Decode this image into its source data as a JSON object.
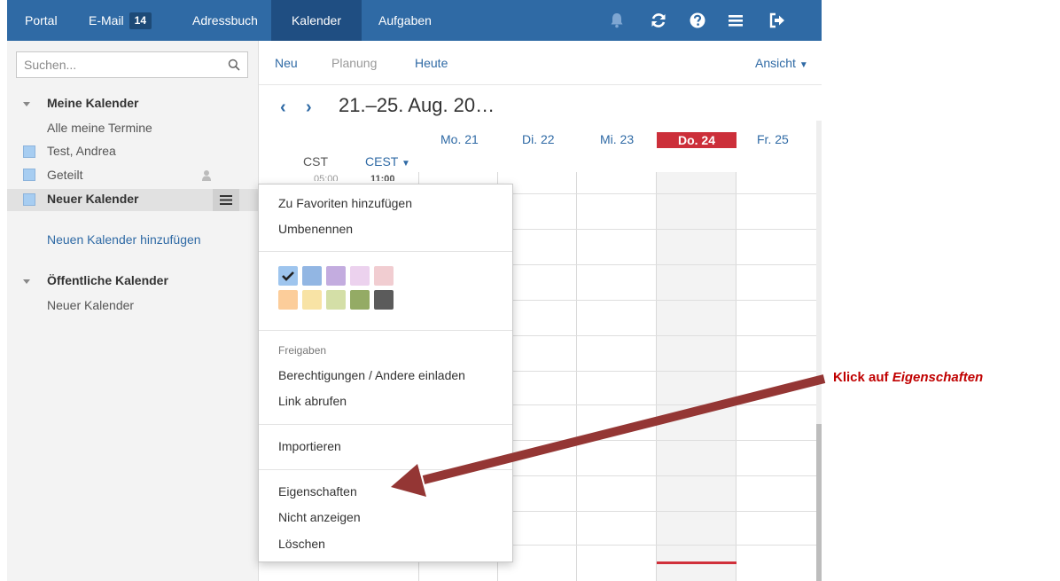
{
  "topbar": {
    "tabs": [
      {
        "label": "Portal"
      },
      {
        "label": "E-Mail",
        "badge": "14"
      },
      {
        "label": "Adressbuch"
      },
      {
        "label": "Kalender",
        "active": true
      },
      {
        "label": "Aufgaben"
      }
    ],
    "icons": [
      "bell-icon",
      "refresh-icon",
      "help-icon",
      "menu-icon",
      "logout-icon"
    ]
  },
  "sidebar": {
    "search_placeholder": "Suchen...",
    "my_calendars": {
      "title": "Meine Kalender",
      "all_label": "Alle meine Termine",
      "items": [
        {
          "label": "Test, Andrea"
        },
        {
          "label": "Geteilt"
        },
        {
          "label": "Neuer Kalender"
        }
      ],
      "add_link": "Neuen Kalender hinzufügen"
    },
    "public_calendars": {
      "title": "Öffentliche Kalender",
      "items": [
        {
          "label": "Neuer Kalender"
        }
      ]
    }
  },
  "toolbar": {
    "new": "Neu",
    "planning": "Planung",
    "today": "Heute",
    "view": "Ansicht"
  },
  "calendar": {
    "range_title": "21.–25. Aug. 20…",
    "days": [
      "Mo. 21",
      "Di. 22",
      "Mi. 23",
      "Do. 24",
      "Fr. 25"
    ],
    "today_index": 3,
    "tz_primary": "CST",
    "tz_secondary": "CEST",
    "time_primary": "05:00",
    "time_secondary": "11:00"
  },
  "context_menu": {
    "add_favorite": "Zu Favoriten hinzufügen",
    "rename": "Umbenennen",
    "sharing_label": "Freigaben",
    "permissions": "Berechtigungen / Andere einladen",
    "get_link": "Link abrufen",
    "import": "Importieren",
    "properties": "Eigenschaften",
    "hide": "Nicht anzeigen",
    "delete": "Löschen",
    "colors": [
      "#9ec5ee",
      "#92b6e3",
      "#c3acdf",
      "#ecd2ee",
      "#f1cdd1",
      "#fccd9a",
      "#f8e3a5",
      "#d4dfa7",
      "#94ab65",
      "#5b5b5b"
    ],
    "selected_color_index": 0
  },
  "annotation": {
    "prefix": "Klick auf ",
    "emphasis": "Eigenschaften",
    "arrow_color": "#943634"
  }
}
